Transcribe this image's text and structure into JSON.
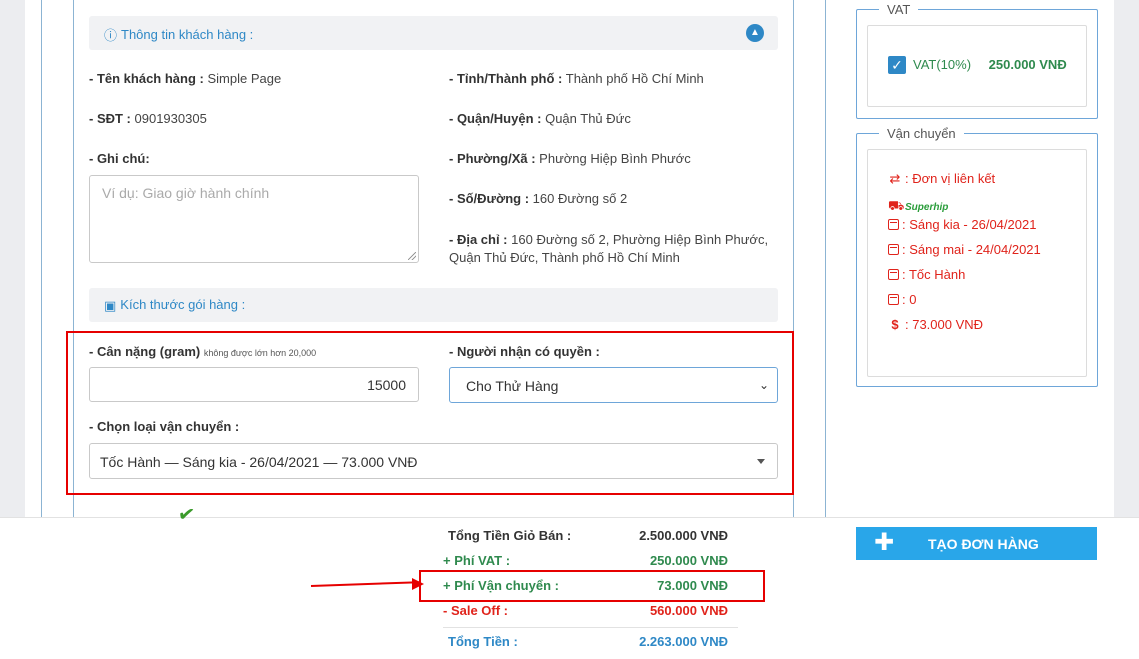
{
  "customer_section": {
    "title": "Thông tin khách hàng :",
    "name_label": "- Tên khách hàng :",
    "name_value": "Simple Page",
    "phone_label": "- SĐT :",
    "phone_value": "0901930305",
    "note_label": "- Ghi chú:",
    "note_placeholder": "Ví dụ: Giao giờ hành chính",
    "city_label": "- Tỉnh/Thành phố :",
    "city_value": "Thành phố Hồ Chí Minh",
    "district_label": "- Quận/Huyện :",
    "district_value": "Quận Thủ Đức",
    "ward_label": "- Phường/Xã :",
    "ward_value": "Phường Hiệp Bình Phước",
    "street_label": "- Số/Đường :",
    "street_value": "160 Đường số 2",
    "address_label": "- Địa chỉ :",
    "address_value_line1": "160 Đường số 2, Phường Hiệp Bình Phước,",
    "address_value_line2": "Quận Thủ Đức, Thành phố Hồ Chí Minh"
  },
  "package_section": {
    "title": "Kích thước gói hàng :",
    "weight_label": "- Cân nặng (gram)",
    "weight_note": "không được lớn hơn 20,000",
    "weight_value": "15000",
    "receiver_label": "- Người nhận có quyền :",
    "receiver_selected": "Cho Thử Hàng",
    "shipping_type_label": "- Chọn loại vận chuyển :",
    "shipping_type_selected": "Tốc Hành — Sáng kia - 26/04/2021 — 73.000 VNĐ"
  },
  "summary": {
    "total_cart_label": "Tổng Tiền Giỏ Bán :",
    "total_cart_value": "2.500.000 VNĐ",
    "vat_fee_label": "+ Phí VAT :",
    "vat_fee_value": "250.000 VNĐ",
    "shipping_fee_label": "+ Phí Vận chuyển :",
    "shipping_fee_value": "73.000 VNĐ",
    "sale_off_label": "- Sale Off :",
    "sale_off_value": "560.000 VNĐ",
    "total_label": "Tổng Tiền :",
    "total_value": "2.263.000 VNĐ"
  },
  "create_order_button": "TẠO ĐƠN HÀNG",
  "vat_panel": {
    "legend": "VAT",
    "checkbox_label": "VAT(10%)",
    "amount": "250.000 VNĐ",
    "checked": true
  },
  "shipping_panel": {
    "legend": "Vận chuyển",
    "partner": ": Đơn vị liên kết",
    "carrier_logo_text": "Superhip",
    "delivery_date": ": Sáng kia - 26/04/2021",
    "pickup_date": ": Sáng mai - 24/04/2021",
    "service": ": Tốc Hành",
    "extra": ": 0",
    "fee": ": 73.000 VNĐ"
  },
  "colors": {
    "accent_blue": "#2e88c6",
    "button_blue": "#29a6e9",
    "green": "#2f8a4e",
    "red": "#e0231b",
    "annotation_red": "#e60000"
  }
}
